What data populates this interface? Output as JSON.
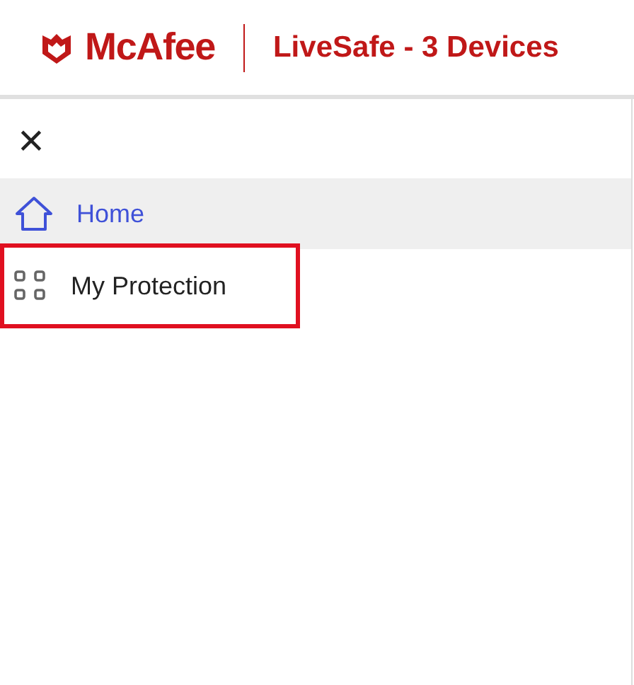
{
  "header": {
    "brand": "McAfee",
    "product": "LiveSafe - 3 Devices"
  },
  "menu": {
    "close": "×",
    "items": [
      {
        "label": "Home",
        "kind": "home",
        "selected": true,
        "highlighted": false
      },
      {
        "label": "My Protection",
        "kind": "grid",
        "selected": false,
        "highlighted": true
      }
    ]
  }
}
